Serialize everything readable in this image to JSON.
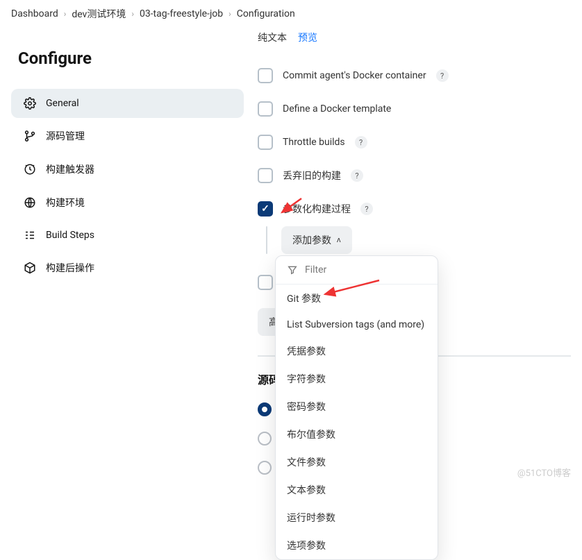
{
  "breadcrumb": [
    "Dashboard",
    "dev测试环境",
    "03-tag-freestyle-job",
    "Configuration"
  ],
  "pageTitle": "Configure",
  "sidebar": {
    "items": [
      {
        "label": "General",
        "icon": "gear-icon",
        "active": true
      },
      {
        "label": "源码管理",
        "icon": "branch-icon"
      },
      {
        "label": "构建触发器",
        "icon": "clock-icon"
      },
      {
        "label": "构建环境",
        "icon": "globe-icon"
      },
      {
        "label": "Build Steps",
        "icon": "steps-icon"
      },
      {
        "label": "构建后操作",
        "icon": "cube-icon"
      }
    ]
  },
  "tabs": {
    "plain": "纯文本",
    "preview": "预览"
  },
  "options": {
    "commitDocker": "Commit agent's Docker container",
    "defineDockerTemplate": "Define a Docker template",
    "throttleBuilds": "Throttle builds",
    "discardOld": "丢弃旧的构建",
    "parameterized": "参数化构建过程",
    "parameterizedHighlight": "参数"
  },
  "addParamButton": "添加参数",
  "advancedButton": "高级",
  "sectionSource": "源码",
  "filterPlaceholder": "Filter",
  "dropdown": {
    "items": [
      "Git 参数",
      "List Subversion tags (and more)",
      "凭据参数",
      "字符参数",
      "密码参数",
      "布尔值参数",
      "文件参数",
      "文本参数",
      "运行时参数",
      "选项参数"
    ]
  },
  "help": "?",
  "watermark": "@51CTO博客"
}
